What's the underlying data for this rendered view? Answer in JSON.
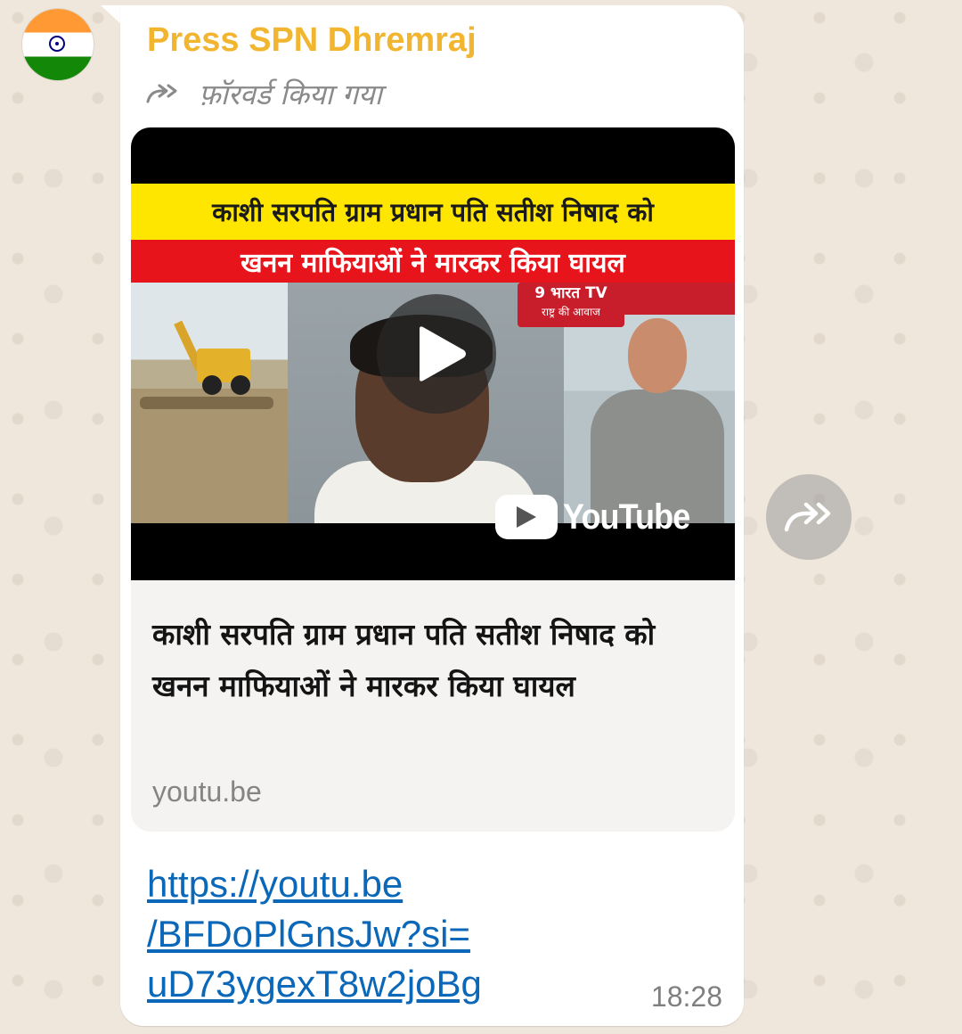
{
  "chat": {
    "sender_name": "Press SPN Dhremraj",
    "forwarded_label": "फ़ॉरवर्ड किया गया",
    "avatar_icon": "indian-flag-avatar",
    "colors": {
      "sender": "#f2b530",
      "link": "#0b67b7",
      "bubble": "#ffffff",
      "wallpaper": "#efe7dc"
    }
  },
  "link_preview": {
    "thumbnail": {
      "headline_line1": "काशी सरपति ग्राम प्रधान पति सतीश निषाद को",
      "headline_line2": "खनन माफियाओं ने मारकर किया घायल",
      "channel_logo_line1": "9 भारत TV",
      "channel_logo_line2": "राष्ट्र की आवाज",
      "platform_label": "YouTube",
      "play_icon": "play-icon"
    },
    "title": "काशी सरपति ग्राम प्रधान पति सतीश निषाद को खनन माफियाओं ने मारकर किया घायल",
    "domain": "youtu.be"
  },
  "message": {
    "url_lines": [
      "https://youtu.be",
      "/BFDoPlGnsJw?si=",
      "uD73ygexT8w2joBg"
    ],
    "timestamp": "18:28"
  },
  "share_button": {
    "icon": "forward-share-icon"
  }
}
